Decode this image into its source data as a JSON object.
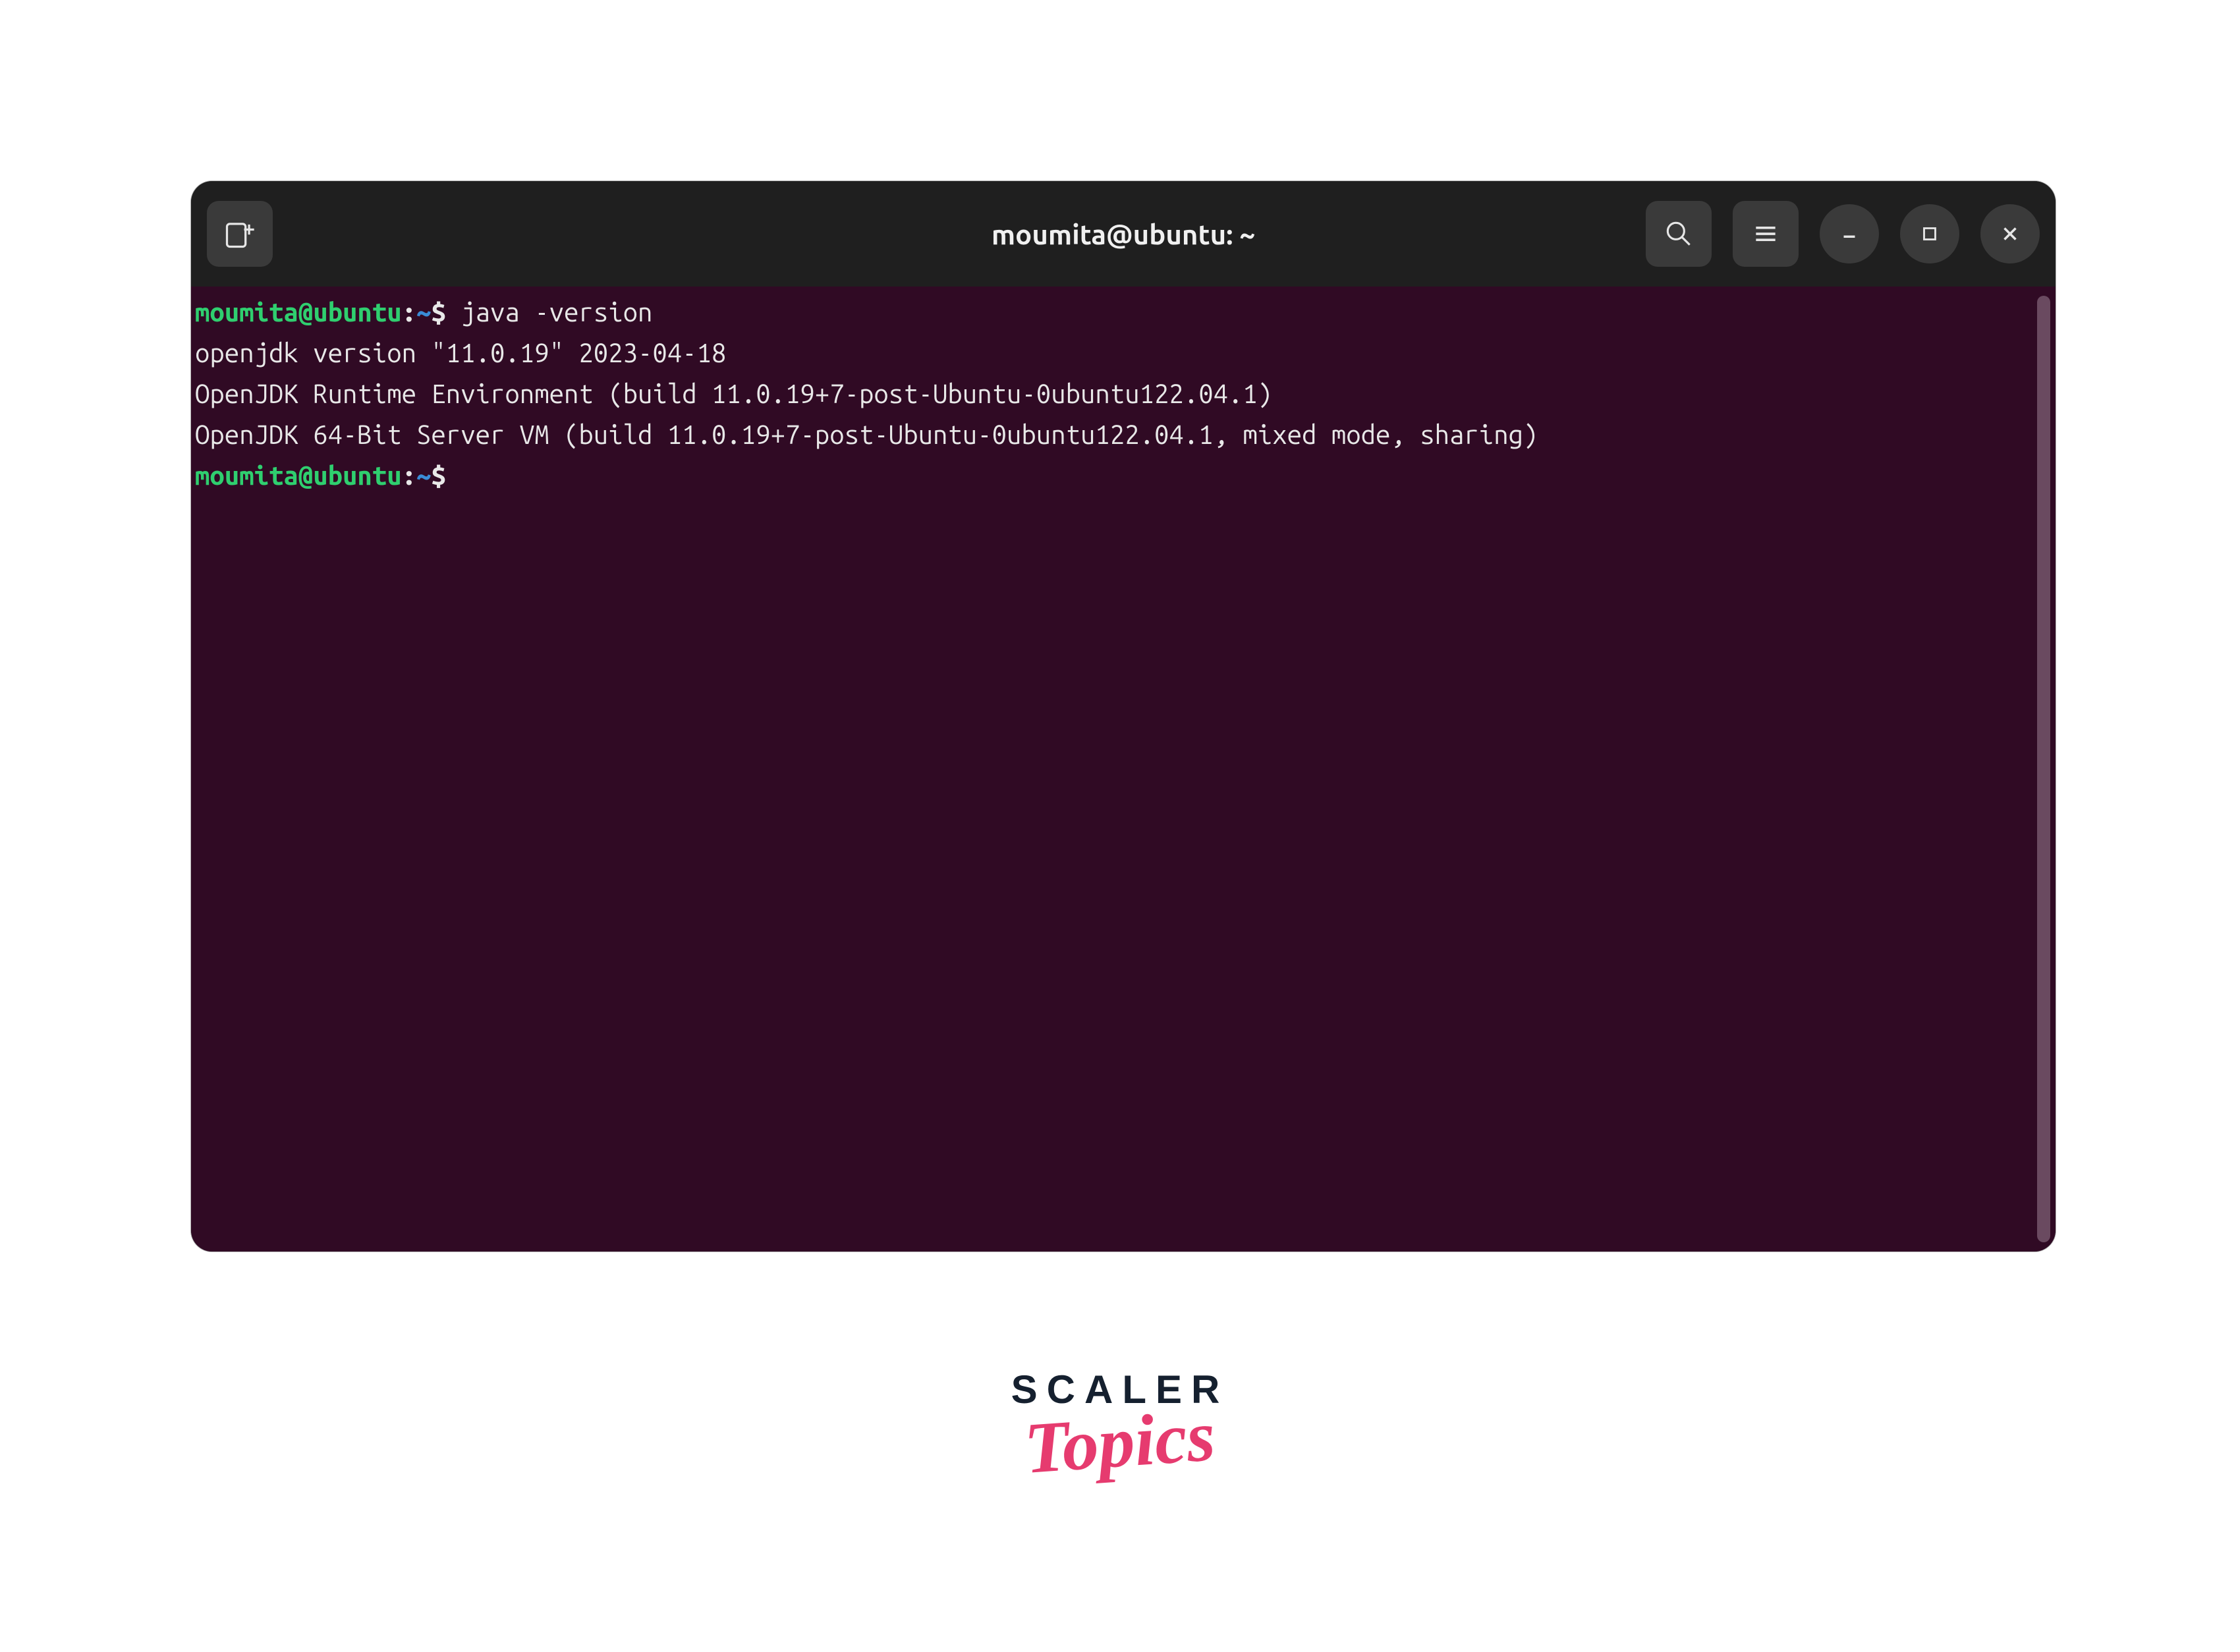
{
  "window": {
    "title": "moumita@ubuntu: ~",
    "buttons": {
      "new_tab_icon": "new-tab",
      "search_icon": "search",
      "menu_icon": "hamburger-menu",
      "minimize_icon": "minimize",
      "maximize_icon": "maximize",
      "close_icon": "close"
    }
  },
  "terminal": {
    "prompt": {
      "user_host": "moumita@ubuntu",
      "separator": ":",
      "path": "~",
      "symbol": "$"
    },
    "lines": [
      {
        "type": "prompt",
        "command": "java -version"
      },
      {
        "type": "output",
        "text": "openjdk version \"11.0.19\" 2023-04-18"
      },
      {
        "type": "output",
        "text": "OpenJDK Runtime Environment (build 11.0.19+7-post-Ubuntu-0ubuntu122.04.1)"
      },
      {
        "type": "output",
        "text": "OpenJDK 64-Bit Server VM (build 11.0.19+7-post-Ubuntu-0ubuntu122.04.1, mixed mode, sharing)"
      },
      {
        "type": "prompt",
        "command": ""
      }
    ]
  },
  "branding": {
    "line1": "SCALER",
    "line2": "Topics"
  }
}
